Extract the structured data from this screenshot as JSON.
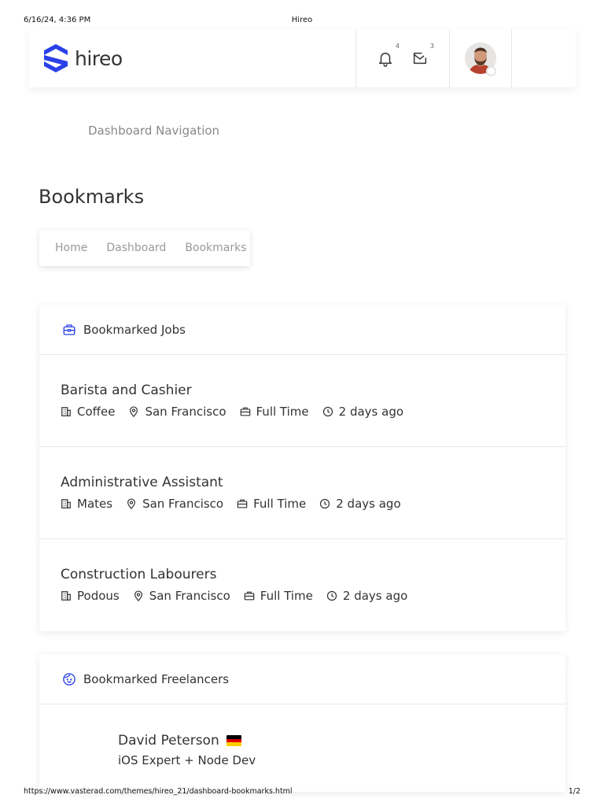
{
  "print": {
    "datetime": "6/16/24, 4:36 PM",
    "page_title": "Hireo",
    "url": "https://www.vasterad.com/themes/hireo_21/dashboard-bookmarks.html",
    "page_num": "1/2"
  },
  "header": {
    "logo_text": "hireo",
    "notifications_count": "4",
    "messages_count": "3",
    "brand_color": "#2a41e8"
  },
  "dashboard_nav_label": "Dashboard Navigation",
  "page_title": "Bookmarks",
  "breadcrumbs": [
    "Home",
    "Dashboard",
    "Bookmarks"
  ],
  "bookmarked_jobs": {
    "title": "Bookmarked Jobs",
    "items": [
      {
        "title": "Barista and Cashier",
        "company": "Coffee",
        "location": "San Francisco",
        "type": "Full Time",
        "posted": "2 days ago"
      },
      {
        "title": "Administrative Assistant",
        "company": "Mates",
        "location": "San Francisco",
        "type": "Full Time",
        "posted": "2 days ago"
      },
      {
        "title": "Construction Labourers",
        "company": "Podous",
        "location": "San Francisco",
        "type": "Full Time",
        "posted": "2 days ago"
      }
    ]
  },
  "bookmarked_freelancers": {
    "title": "Bookmarked Freelancers",
    "items": [
      {
        "name": "David Peterson",
        "role": "iOS Expert + Node Dev",
        "flag": "de"
      }
    ]
  }
}
